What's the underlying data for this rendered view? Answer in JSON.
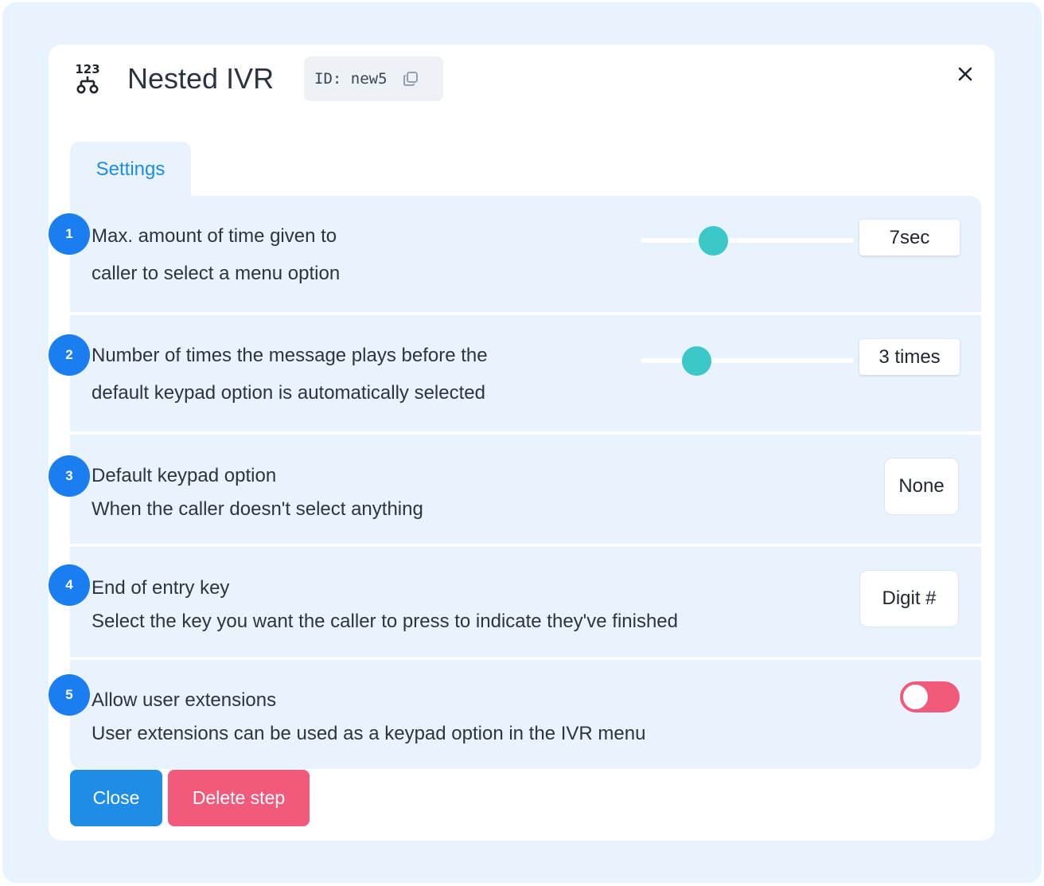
{
  "header": {
    "icon": "ivr-keypad-tree-icon",
    "icon_text": "123",
    "title": "Nested IVR",
    "id_label": "ID: new5",
    "copy_icon": "copy-icon",
    "close_icon": "close-icon"
  },
  "tabs": [
    {
      "label": "Settings",
      "active": true
    }
  ],
  "settings": [
    {
      "number": "1",
      "line1": "Max. amount of time given to",
      "line2": "caller to select a menu option",
      "control": "slider",
      "value": "7sec"
    },
    {
      "number": "2",
      "line1": "Number of times the message plays before the",
      "line2": "default keypad option is automatically selected",
      "control": "slider",
      "value": "3 times"
    },
    {
      "number": "3",
      "line1": "Default keypad option",
      "line2": "When the caller doesn't select anything",
      "control": "select",
      "value": "None"
    },
    {
      "number": "4",
      "line1": "End of entry key",
      "line2": "Select the key you want the caller to press to indicate they've finished",
      "control": "select",
      "value": "Digit #"
    },
    {
      "number": "5",
      "line1": "Allow user extensions",
      "line2": "User extensions can be used as a keypad option in the IVR menu",
      "control": "toggle",
      "value": false
    }
  ],
  "footer": {
    "close_label": "Close",
    "delete_label": "Delete step"
  },
  "colors": {
    "accent": "#1f8ce6",
    "badge": "#1a7ef0",
    "slider_thumb": "#3cc7c8",
    "danger": "#f25a7c",
    "panel_bg": "#e8f3fd"
  }
}
